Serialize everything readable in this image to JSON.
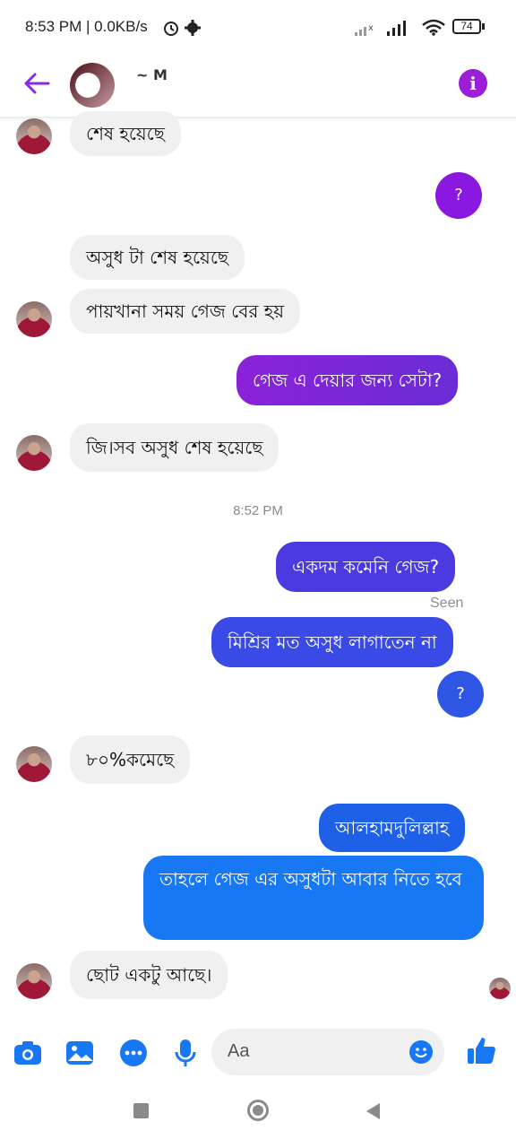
{
  "status_bar": {
    "time_text": "8:53 PM | 0.0KB/s",
    "battery_level": "74"
  },
  "header": {
    "contact_name": "~ M"
  },
  "messages": [
    {
      "side": "in",
      "text": "শেষ হয়েছে"
    },
    {
      "side": "out",
      "text": "?"
    },
    {
      "side": "in",
      "text": "অসুধ টা শেষ হয়েছে"
    },
    {
      "side": "in",
      "text": "পায়খানা সময় গেজ বের হয়"
    },
    {
      "side": "out",
      "text": "গেজ এ দেয়ার জন্য সেটা?"
    },
    {
      "side": "in",
      "text": "জি।সব অসুধ শেষ হয়েছে"
    },
    {
      "side": "out",
      "text": "একদম কমেনি গেজ?"
    },
    {
      "side": "out",
      "text": "মিশ্রির মত অসুধ লাগাতেন না"
    },
    {
      "side": "out",
      "text": "?"
    },
    {
      "side": "in",
      "text": "৮০%কমেছে"
    },
    {
      "side": "out",
      "text": "আলহামদুলিল্লাহ"
    },
    {
      "side": "out",
      "text": "তাহলে গেজ এর অসুধটা আবার নিতে হবে"
    },
    {
      "side": "in",
      "text": "ছোট একটু আছে।"
    }
  ],
  "timestamp": "8:52 PM",
  "seen_label": "Seen",
  "composer": {
    "placeholder": "Aa"
  },
  "colors": {
    "purple": "#8a2be2",
    "blue": "#1a73e8",
    "incoming_bubble": "#f1f0f0"
  }
}
